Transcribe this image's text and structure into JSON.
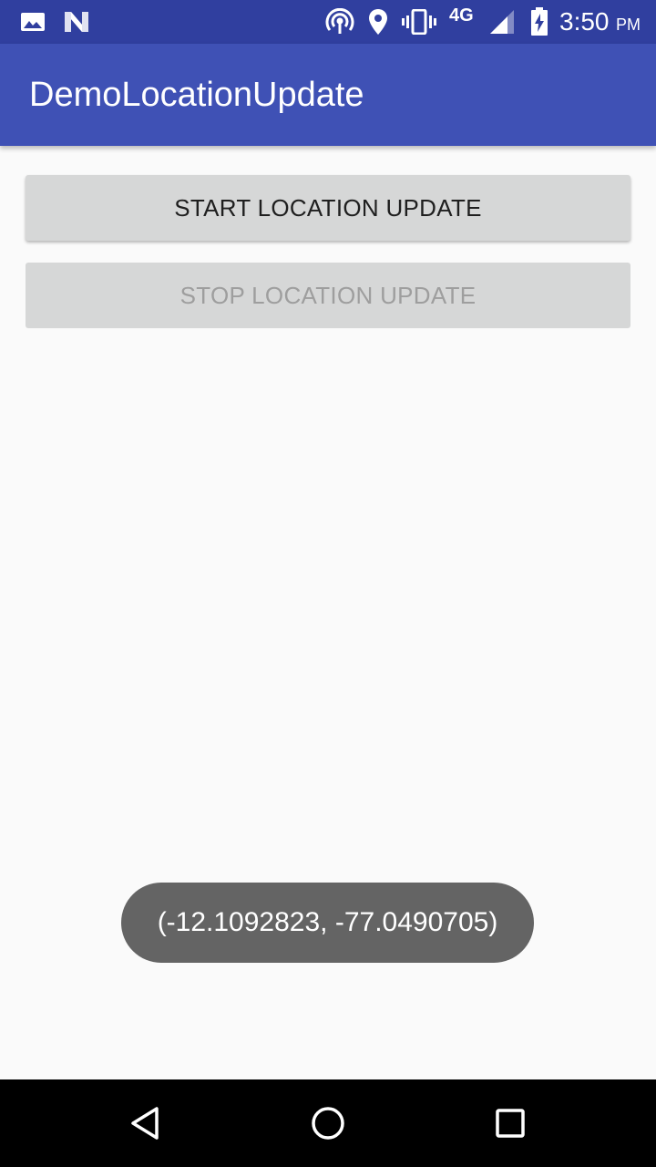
{
  "status_bar": {
    "network": "4G",
    "time": "3:50",
    "ampm": "PM",
    "icons": [
      "image-icon",
      "n-notification-icon",
      "hotspot-icon",
      "location-icon",
      "vibrate-icon",
      "signal-icon",
      "battery-charging-icon"
    ]
  },
  "app_bar": {
    "title": "DemoLocationUpdate"
  },
  "buttons": {
    "start_label": "START LOCATION UPDATE",
    "stop_label": "STOP LOCATION UPDATE"
  },
  "toast": {
    "text": "(-12.1092823, -77.0490705)"
  },
  "nav_bar": {
    "icons": [
      "back-icon",
      "home-icon",
      "recents-icon"
    ]
  },
  "colors": {
    "status_bar": "#303f9f",
    "app_bar": "#3f51b5",
    "background": "#fafafa",
    "button": "#d6d7d7",
    "toast": "#646464"
  }
}
